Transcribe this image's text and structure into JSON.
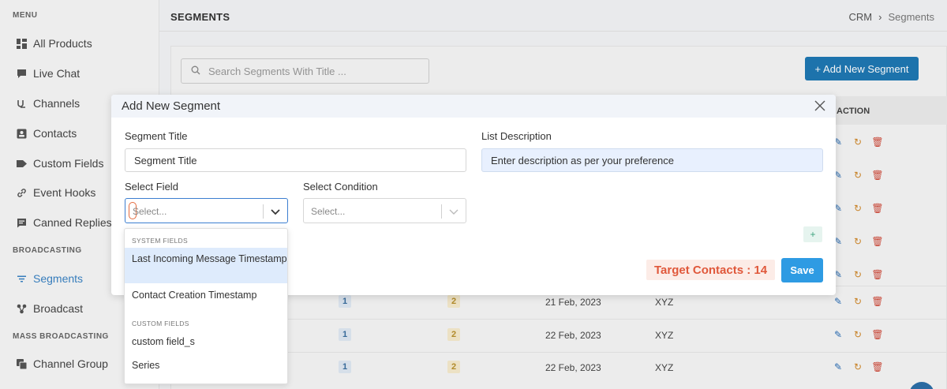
{
  "sidebar": {
    "sections": [
      "MENU",
      "BROADCASTING",
      "MASS BROADCASTING"
    ],
    "items": [
      {
        "label": "All Products",
        "icon": "grid-icon"
      },
      {
        "label": "Live Chat",
        "icon": "chat-icon"
      },
      {
        "label": "Channels",
        "icon": "channels-icon"
      },
      {
        "label": "Contacts",
        "icon": "contact-card-icon"
      },
      {
        "label": "Custom Fields",
        "icon": "tag-icon"
      },
      {
        "label": "Event Hooks",
        "icon": "link-icon"
      },
      {
        "label": "Canned Replies",
        "icon": "message-icon"
      },
      {
        "label": "Segments",
        "icon": "filter-icon",
        "active": true
      },
      {
        "label": "Broadcast",
        "icon": "broadcast-icon"
      },
      {
        "label": "Channel Group",
        "icon": "channel-group-icon"
      }
    ]
  },
  "header": {
    "title": "SEGMENTS",
    "breadcrumb": [
      "CRM",
      "›",
      "Segments"
    ]
  },
  "toolbar": {
    "search_placeholder": "Search Segments With Title ...",
    "add_label": "+ Add New Segment"
  },
  "table": {
    "action_header": "ACTION",
    "visible_rows": [
      {
        "col1": "1",
        "col2": "2",
        "date": "21 Feb, 2023",
        "owner": "XYZ"
      },
      {
        "col1": "1",
        "col2": "2",
        "date": "22 Feb, 2023",
        "owner": "XYZ"
      },
      {
        "col1": "1",
        "col2": "2",
        "date": "22 Feb, 2023",
        "owner": "XYZ"
      }
    ]
  },
  "modal": {
    "title": "Add New Segment",
    "segment_title_label": "Segment Title",
    "segment_title_value": "Segment Title",
    "list_description_label": "List Description",
    "list_description_value": "Enter description as per your preference",
    "select_field_label": "Select Field",
    "select_field_placeholder": "Select...",
    "select_condition_label": "Select Condition",
    "select_condition_placeholder": "Select...",
    "add_condition_label": "+",
    "target_contacts": "Target Contacts : 14",
    "save_label": "Save"
  },
  "dropdown": {
    "system_group": "SYSTEM FIELDS",
    "system_options": [
      "Last Incoming Message Timestamp",
      "Contact Creation Timestamp"
    ],
    "custom_group": "CUSTOM FIELDS",
    "custom_options": [
      "custom field_s",
      "Series"
    ]
  },
  "colors": {
    "primary": "#1f78b4",
    "save": "#2e9be3",
    "target_text": "#e0583b",
    "target_bg": "#fcece7",
    "active_nav": "#3a83c4"
  }
}
